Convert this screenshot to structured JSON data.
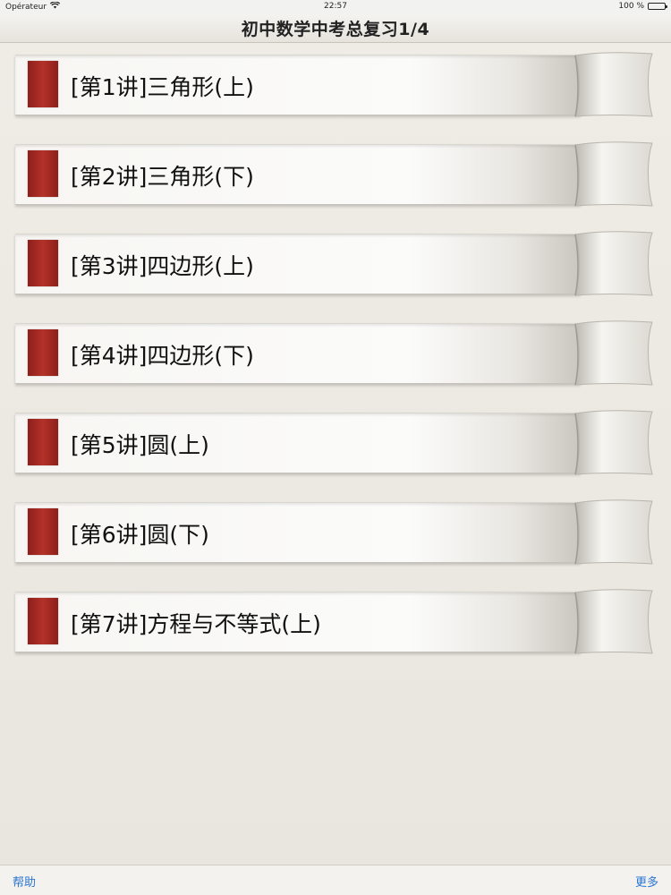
{
  "status_bar": {
    "carrier": "Opérateur",
    "time": "22:57",
    "battery": "100 %"
  },
  "nav": {
    "title": "初中数学中考总复习1/4"
  },
  "lessons": [
    {
      "label": "[第1讲]三角形(上)"
    },
    {
      "label": "[第2讲]三角形(下)"
    },
    {
      "label": "[第3讲]四边形(上)"
    },
    {
      "label": "[第4讲]四边形(下)"
    },
    {
      "label": "[第5讲]圆(上)"
    },
    {
      "label": "[第6讲]圆(下)"
    },
    {
      "label": "[第7讲]方程与不等式(上)"
    }
  ],
  "toolbar": {
    "help_label": "帮助",
    "more_label": "更多"
  },
  "colors": {
    "marker": "#a52a24",
    "link": "#2a76d2"
  }
}
